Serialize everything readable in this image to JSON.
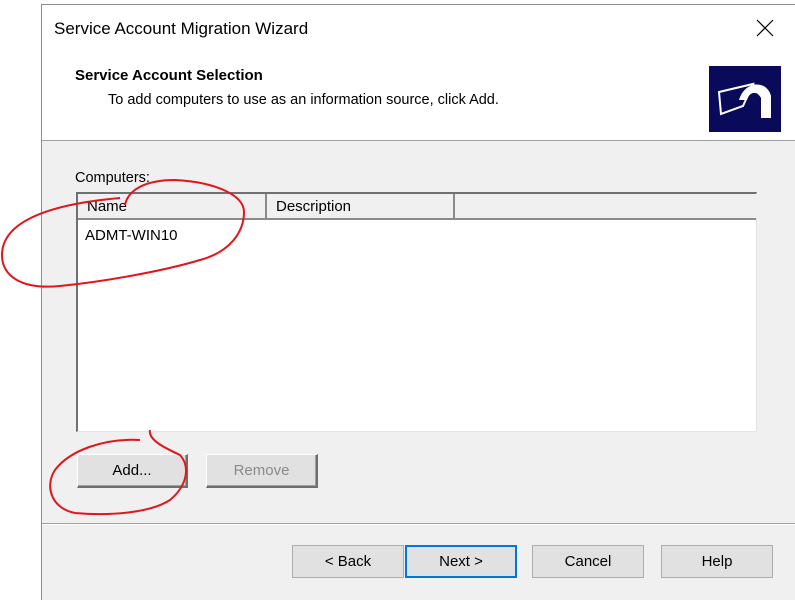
{
  "window": {
    "title": "Service Account Migration Wizard"
  },
  "header": {
    "title": "Service Account Selection",
    "subtitle": "To add computers to use as an information source, click Add.",
    "icon": "wizard-logo-icon"
  },
  "computers": {
    "label": "Computers:",
    "columns": [
      "Name",
      "Description",
      ""
    ],
    "rows": [
      {
        "name": "ADMT-WIN10",
        "description": ""
      }
    ]
  },
  "list_buttons": {
    "add_label": "Add...",
    "remove_label": "Remove"
  },
  "footer": {
    "back_label": "< Back",
    "next_label": "Next >",
    "cancel_label": "Cancel",
    "help_label": "Help"
  },
  "colors": {
    "annotation": "#e0161a",
    "focus": "#0078d7",
    "icon_bg": "#0a0a5a"
  }
}
